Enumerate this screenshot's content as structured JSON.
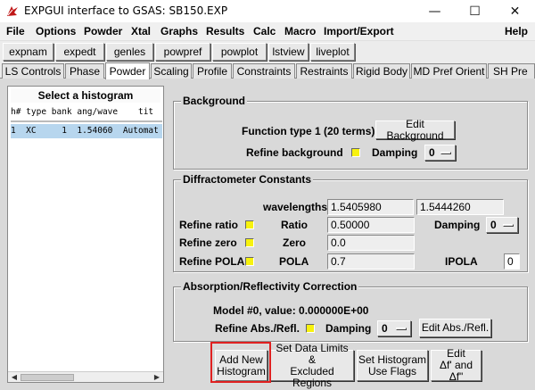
{
  "window": {
    "title": "EXPGUI interface to GSAS: SB150.EXP",
    "minimize_glyph": "—",
    "maximize_glyph": "☐",
    "close_glyph": "✕"
  },
  "menu": {
    "items": [
      "File",
      "Options",
      "Powder",
      "Xtal",
      "Graphs",
      "Results",
      "Calc",
      "Macro",
      "Import/Export"
    ],
    "help": "Help"
  },
  "toolbar": {
    "buttons": [
      "expnam",
      "expedt",
      "genles",
      "powpref",
      "powplot",
      "lstview",
      "liveplot"
    ]
  },
  "tabs": {
    "items": [
      "LS Controls",
      "Phase",
      "Powder",
      "Scaling",
      "Profile",
      "Constraints",
      "Restraints",
      "Rigid Body",
      "MD Pref Orient",
      "SH Pre"
    ],
    "active": "Powder"
  },
  "histogram_list": {
    "title": "Select a histogram",
    "header": "h# type bank ang/wave    tit",
    "rows": [
      {
        "text": "1  XC     1  1.54060  Automat"
      }
    ]
  },
  "background": {
    "legend": "Background",
    "function_text": "Function type 1  (20 terms)",
    "edit_button": "Edit Background",
    "refine_label": "Refine background",
    "damping_label": "Damping",
    "damping_value": "0"
  },
  "diffractometer": {
    "legend": "Diffractometer Constants",
    "wavelengths_label": "wavelengths",
    "wavelength1": "1.5405980",
    "wavelength2": "1.5444260",
    "refine_ratio_label": "Refine ratio",
    "ratio_label": "Ratio",
    "ratio_value": "0.50000",
    "damping_label": "Damping",
    "damping_value": "0",
    "refine_zero_label": "Refine zero",
    "zero_label": "Zero",
    "zero_value": "0.0",
    "refine_pola_label": "Refine POLA",
    "pola_label": "POLA",
    "pola_value": "0.7",
    "ipola_label": "IPOLA",
    "ipola_value": "0"
  },
  "absorption": {
    "legend": "Absorption/Reflectivity Correction",
    "model_text": "Model #0, value: 0.000000E+00",
    "refine_label": "Refine Abs./Refl.",
    "damping_label": "Damping",
    "damping_value": "0",
    "edit_button": "Edit Abs./Refl."
  },
  "bottom_buttons": {
    "add_new": [
      "Add New",
      "Histogram"
    ],
    "set_limits": [
      "Set Data Limits &",
      "Excluded Regions"
    ],
    "set_flags": [
      "Set Histogram",
      "Use Flags"
    ],
    "edit_df": [
      "Edit",
      "Δf' and Δf\""
    ]
  },
  "colors": {
    "checkbox": "#f7f20e",
    "selected_row": "#b7d6ee",
    "highlight_box": "#e02020",
    "panel_bg": "#d9d9d9"
  }
}
